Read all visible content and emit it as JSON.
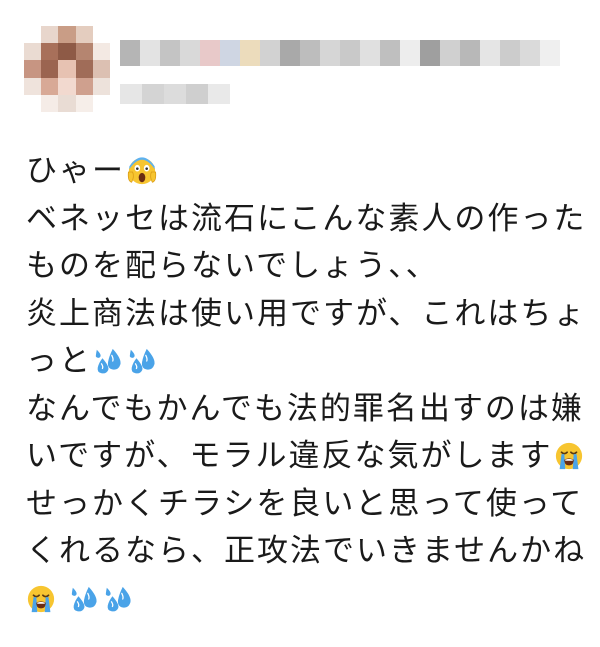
{
  "post": {
    "author": {
      "avatar": "pixelated-avatar",
      "display_name_redacted": true,
      "handle_redacted": true
    },
    "lines": [
      {
        "text": "ひゃー",
        "emojis_after": [
          "scream-emoji"
        ]
      },
      {
        "text": "ベネッセは流石にこんな素人の作った",
        "emojis_after": []
      },
      {
        "text": "ものを配らないでしょう、、",
        "emojis_after": []
      },
      {
        "text": "炎上商法は使い用ですが、これはちょ",
        "emojis_after": []
      },
      {
        "text": "っと",
        "emojis_after": [
          "sweat-droplets-emoji",
          "sweat-droplets-emoji"
        ]
      },
      {
        "text": "なんでも法的罪名出すのは嫌",
        "prefix": "なんでもかん",
        "emojis_after": []
      },
      {
        "text": "いですが、モラル違反な気がします",
        "emojis_after": [
          "loudly-crying-emoji"
        ]
      },
      {
        "text": "せっかくチラシを良いと思って使って",
        "emojis_after": []
      },
      {
        "text": "くれるなら、正攻法でいきませんかね",
        "emojis_after": []
      },
      {
        "text": "",
        "emojis_after": [
          "loudly-crying-emoji",
          "sweat-droplets-emoji",
          "sweat-droplets-emoji"
        ]
      }
    ],
    "line_texts": {
      "l0": "ひゃー",
      "l1": "ベネッセは流石にこんな素人の作った",
      "l2": "ものを配らないでしょう、、",
      "l3": "炎上商法は使い用ですが、これはちょ",
      "l4": "っと",
      "l5": "なんでもかんでも法的罪名出すのは嫌",
      "l6": "いですが、モラル違反な気がします",
      "l7": "せっかくチラシを良いと思って使って",
      "l8": "くれるなら、正攻法でいきませんかね"
    }
  },
  "colors": {
    "text": "#1a1a1a",
    "background": "#ffffff",
    "emoji_yellow": "#f7c530",
    "emoji_blue": "#4aa3e8"
  }
}
